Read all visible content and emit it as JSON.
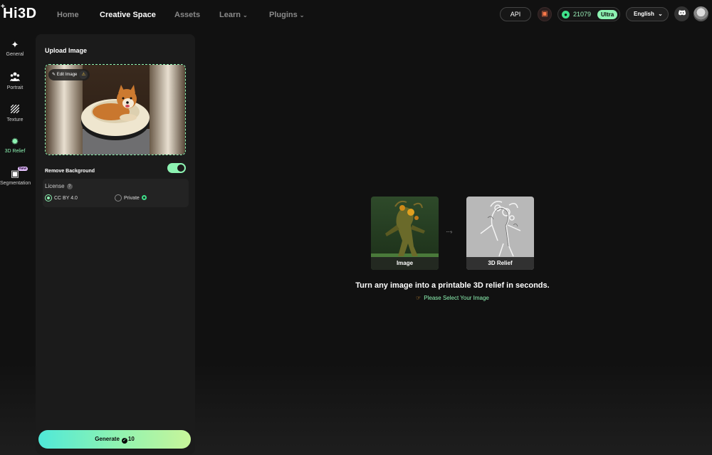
{
  "header": {
    "logo": "Hi3D",
    "logo_plus": "+",
    "nav": [
      {
        "label": "Home"
      },
      {
        "label": "Creative Space"
      },
      {
        "label": "Assets"
      },
      {
        "label": "Learn"
      },
      {
        "label": "Plugins"
      }
    ],
    "api_label": "API",
    "credits": "21079",
    "plan_badge": "Ultra",
    "language": "English"
  },
  "rail": {
    "items": [
      {
        "label": "General",
        "icon": "sparkle-icon"
      },
      {
        "label": "Portrait",
        "icon": "people-icon"
      },
      {
        "label": "Texture",
        "icon": "texture-icon"
      },
      {
        "label": "3D Relief",
        "icon": "relief-icon"
      },
      {
        "label": "Segmentation",
        "icon": "segmentation-icon"
      }
    ],
    "new_badge": "New"
  },
  "panel": {
    "upload_title": "Upload Image",
    "edit_image": "Edit Image",
    "remove_bg_label": "Remove Background",
    "remove_bg_on": true,
    "license_title": "License",
    "license_options": [
      "CC BY 4.0",
      "Private"
    ],
    "license_selected": "CC BY 4.0",
    "generate_label": "Generate",
    "generate_cost": "10"
  },
  "preview": {
    "image_label": "Image",
    "relief_label": "3D Relief",
    "arrow": "····›",
    "headline": "Turn any image into a printable 3D relief in seconds.",
    "hint": "Please Select Your Image"
  },
  "colors": {
    "accent": "#8df3b2",
    "background": "#111111",
    "panel": "#1b1b1b"
  }
}
